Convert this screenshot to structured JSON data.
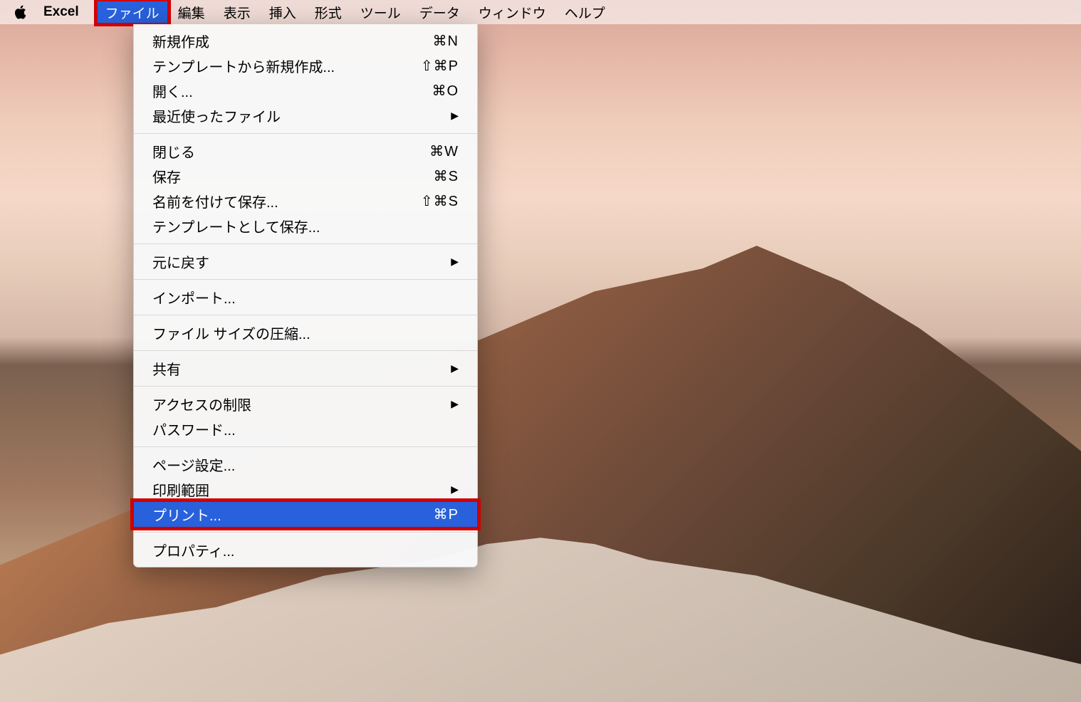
{
  "menubar": {
    "app_name": "Excel",
    "items": [
      {
        "label": "ファイル",
        "active": true,
        "highlighted": true
      },
      {
        "label": "編集"
      },
      {
        "label": "表示"
      },
      {
        "label": "挿入"
      },
      {
        "label": "形式"
      },
      {
        "label": "ツール"
      },
      {
        "label": "データ"
      },
      {
        "label": "ウィンドウ"
      },
      {
        "label": "ヘルプ"
      }
    ]
  },
  "dropdown": {
    "groups": [
      [
        {
          "label": "新規作成",
          "shortcut": "⌘N"
        },
        {
          "label": "テンプレートから新規作成...",
          "shortcut": "⇧⌘P"
        },
        {
          "label": "開く...",
          "shortcut": "⌘O"
        },
        {
          "label": "最近使ったファイル",
          "submenu": true
        }
      ],
      [
        {
          "label": "閉じる",
          "shortcut": "⌘W"
        },
        {
          "label": "保存",
          "shortcut": "⌘S"
        },
        {
          "label": "名前を付けて保存...",
          "shortcut": "⇧⌘S"
        },
        {
          "label": "テンプレートとして保存..."
        }
      ],
      [
        {
          "label": "元に戻す",
          "submenu": true
        }
      ],
      [
        {
          "label": "インポート..."
        }
      ],
      [
        {
          "label": "ファイル サイズの圧縮..."
        }
      ],
      [
        {
          "label": "共有",
          "submenu": true
        }
      ],
      [
        {
          "label": "アクセスの制限",
          "submenu": true
        },
        {
          "label": "パスワード..."
        }
      ],
      [
        {
          "label": "ページ設定..."
        },
        {
          "label": "印刷範囲",
          "submenu": true
        },
        {
          "label": "プリント...",
          "shortcut": "⌘P",
          "selected": true,
          "highlighted": true
        }
      ],
      [
        {
          "label": "プロパティ..."
        }
      ]
    ]
  }
}
